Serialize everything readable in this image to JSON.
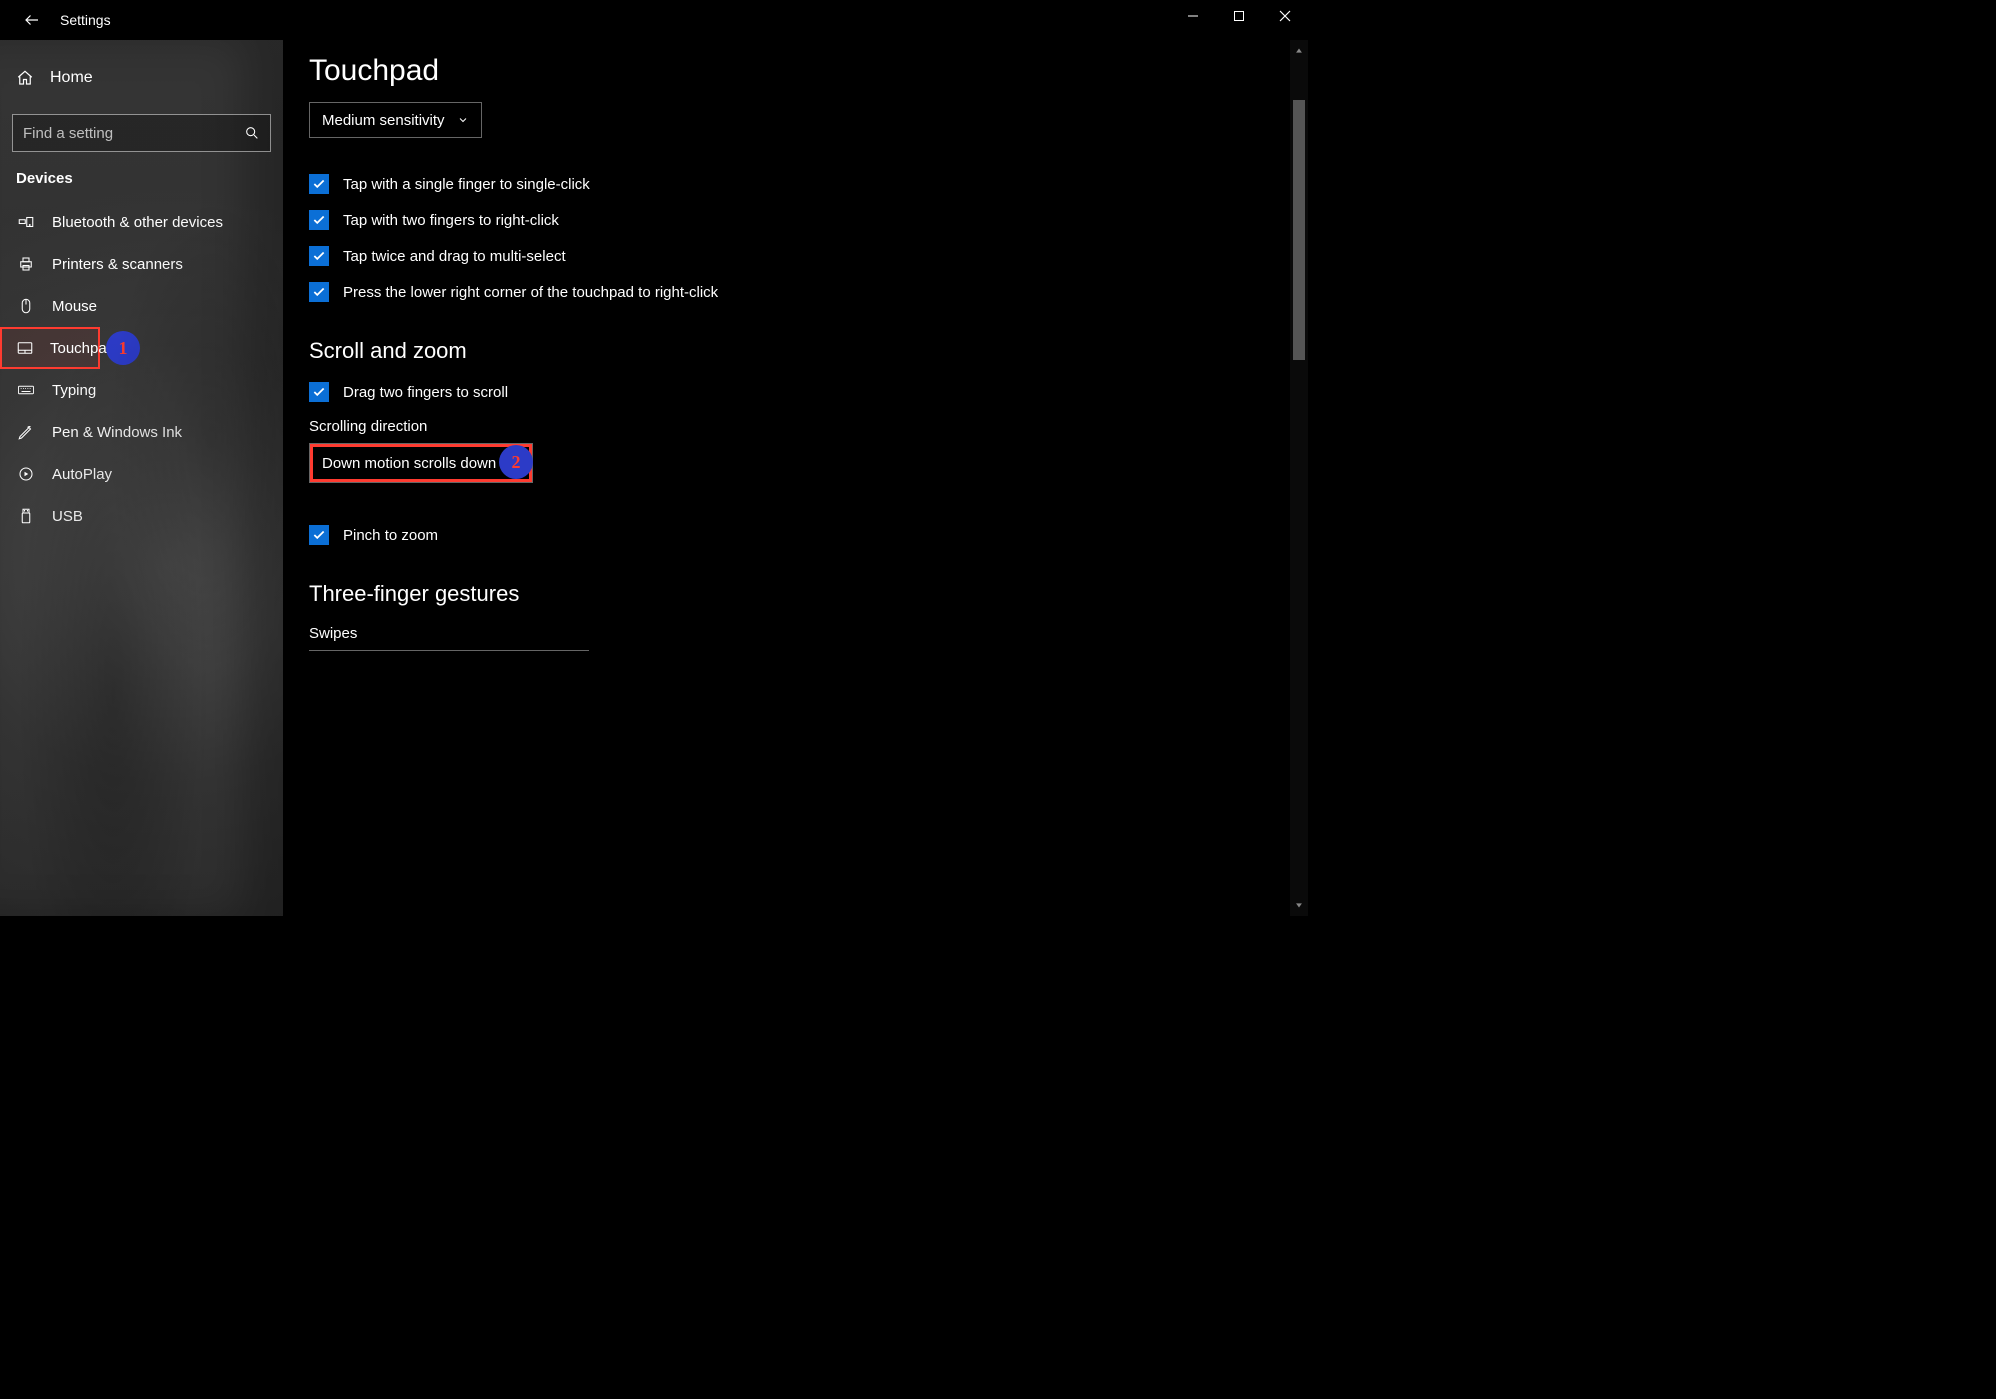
{
  "window": {
    "title": "Settings"
  },
  "sidebar": {
    "home": "Home",
    "search_placeholder": "Find a setting",
    "category": "Devices",
    "items": [
      {
        "label": "Bluetooth & other devices",
        "icon": "bluetooth-devices-icon"
      },
      {
        "label": "Printers & scanners",
        "icon": "printer-icon"
      },
      {
        "label": "Mouse",
        "icon": "mouse-icon"
      },
      {
        "label": "Touchpad",
        "icon": "touchpad-icon",
        "selected": true
      },
      {
        "label": "Typing",
        "icon": "keyboard-icon"
      },
      {
        "label": "Pen & Windows Ink",
        "icon": "pen-icon"
      },
      {
        "label": "AutoPlay",
        "icon": "autoplay-icon"
      },
      {
        "label": "USB",
        "icon": "usb-icon"
      }
    ]
  },
  "page": {
    "title": "Touchpad",
    "sensitivity": {
      "value": "Medium sensitivity"
    },
    "taps": [
      "Tap with a single finger to single-click",
      "Tap with two fingers to right-click",
      "Tap twice and drag to multi-select",
      "Press the lower right corner of the touchpad to right-click"
    ],
    "scroll_zoom": {
      "heading": "Scroll and zoom",
      "drag_two_fingers": "Drag two fingers to scroll",
      "direction_label": "Scrolling direction",
      "direction_value": "Down motion scrolls down",
      "pinch": "Pinch to zoom"
    },
    "three_finger": {
      "heading": "Three-finger gestures",
      "swipes_label": "Swipes"
    }
  },
  "annotations": {
    "badge1": "1",
    "badge2": "2"
  }
}
